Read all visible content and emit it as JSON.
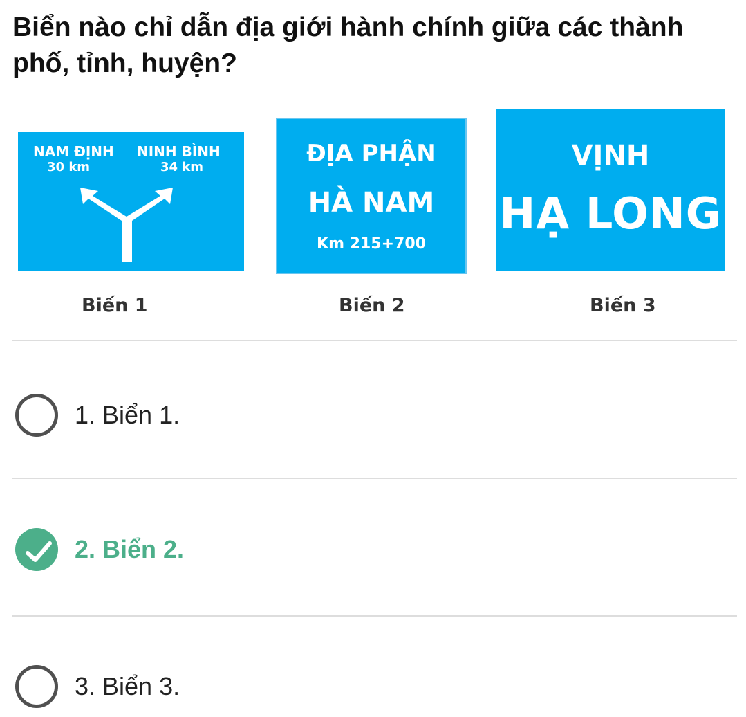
{
  "question": "Biển nào chỉ dẫn địa giới hành chính giữa các thành phố, tỉnh, huyện?",
  "signs": [
    {
      "caption": "Biến 1",
      "left_place": "NAM ĐỊNH",
      "left_distance": "30 km",
      "right_place": "NINH BÌNH",
      "right_distance": "34 km",
      "icon": "fork-arrow-icon"
    },
    {
      "caption": "Biến 2",
      "line1": "ĐỊA PHẬN",
      "line2": "HÀ NAM",
      "line3": "Km 215+700"
    },
    {
      "caption": "Biến 3",
      "line1": "VỊNH",
      "line2": "HẠ LONG"
    }
  ],
  "options": [
    {
      "label": "1. Biển 1.",
      "selected": false,
      "correct": false
    },
    {
      "label": "2. Biển 2.",
      "selected": true,
      "correct": true
    },
    {
      "label": "3. Biển 3.",
      "selected": false,
      "correct": false
    }
  ],
  "colors": {
    "sign_blue": "#00adef",
    "correct_green": "#4caf8a",
    "radio_border": "#505050",
    "divider": "#dddddd"
  }
}
